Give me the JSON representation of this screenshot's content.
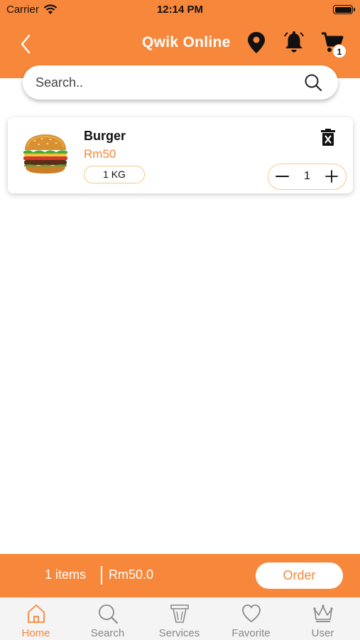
{
  "status_bar": {
    "carrier": "Carrier",
    "time": "12:14 PM"
  },
  "header": {
    "title": "Qwik Online",
    "cart_count": "1"
  },
  "search": {
    "placeholder": "Search.."
  },
  "cart_items": [
    {
      "name": "Burger",
      "price": "Rm50",
      "unit": "1 KG",
      "quantity": "1"
    }
  ],
  "summary": {
    "items_label": "1 items",
    "total": "Rm50.0",
    "order_label": "Order"
  },
  "tabs": [
    {
      "label": "Home",
      "icon": "home-icon",
      "active": true
    },
    {
      "label": "Search",
      "icon": "search-icon",
      "active": false
    },
    {
      "label": "Services",
      "icon": "services-icon",
      "active": false
    },
    {
      "label": "Favorite",
      "icon": "heart-icon",
      "active": false
    },
    {
      "label": "User",
      "icon": "crown-icon",
      "active": false
    }
  ],
  "colors": {
    "accent": "#f7873a",
    "accent_light": "#f5c98a",
    "inactive": "#888888"
  }
}
